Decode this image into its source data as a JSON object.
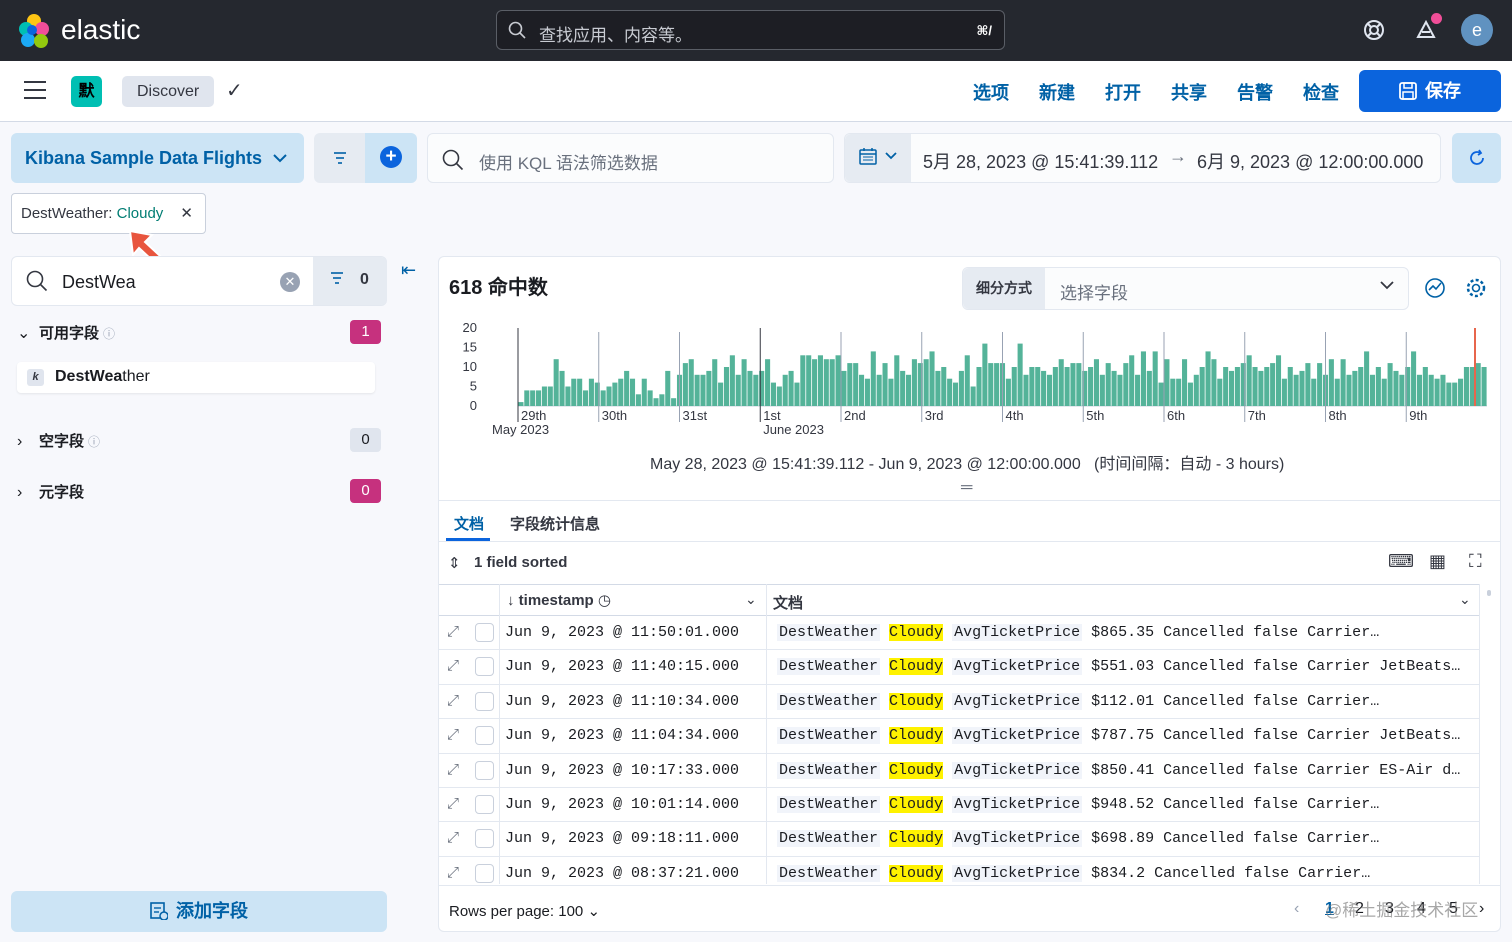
{
  "header": {
    "logo_text": "elastic",
    "search_placeholder": "查找应用、内容等。",
    "search_shortcut": "⌘/",
    "avatar_letter": "e"
  },
  "appbar": {
    "space_badge": "默",
    "breadcrumb": "Discover",
    "links": [
      "选项",
      "新建",
      "打开",
      "共享",
      "告警",
      "检查"
    ],
    "save_label": "保存"
  },
  "querybar": {
    "data_view": "Kibana Sample Data Flights",
    "kql_placeholder": "使用 KQL 语法筛选数据",
    "date_start": "5月 28, 2023 @ 15:41:39.112",
    "date_end": "6月 9, 2023 @ 12:00:00.000",
    "filter_pill": {
      "field": "DestWeather: ",
      "value": "Cloudy"
    }
  },
  "sidebar": {
    "search_value": "DestWea",
    "filter_count": "0",
    "sections": [
      {
        "label": "可用字段",
        "count": "1"
      },
      {
        "label": "空字段",
        "count": "0"
      },
      {
        "label": "元字段",
        "count": "0"
      }
    ],
    "field": {
      "type": "k",
      "match": "DestWea",
      "rest": "ther"
    },
    "add_field_label": "添加字段"
  },
  "main": {
    "hits": "618 命中数",
    "breakdown_label": "细分方式",
    "breakdown_placeholder": "选择字段",
    "interval_text": "May 28, 2023 @ 15:41:39.112 - Jun 9, 2023 @ 12:00:00.000   (时间间隔：自动 - 3 hours)",
    "tabs": [
      "文档",
      "字段统计信息"
    ],
    "sort_text": "1 field sorted",
    "columns": {
      "timestamp": "timestamp",
      "document": "文档"
    },
    "rows_per_page": "Rows per page: 100",
    "pages": [
      "1",
      "2",
      "3",
      "4",
      "5"
    ],
    "watermark": "@稀土掘金技术社区"
  },
  "rows": [
    {
      "ts": "Jun 9, 2023 @ 11:50:01.000",
      "price": "$865.35",
      "rest": "Cancelled false Carrier…"
    },
    {
      "ts": "Jun 9, 2023 @ 11:40:15.000",
      "price": "$551.03",
      "rest": "Cancelled false Carrier JetBeats…"
    },
    {
      "ts": "Jun 9, 2023 @ 11:10:34.000",
      "price": "$112.01",
      "rest": "Cancelled false Carrier…"
    },
    {
      "ts": "Jun 9, 2023 @ 11:04:34.000",
      "price": "$787.75",
      "rest": "Cancelled false Carrier JetBeats…"
    },
    {
      "ts": "Jun 9, 2023 @ 10:17:33.000",
      "price": "$850.41",
      "rest": "Cancelled false Carrier ES-Air d…"
    },
    {
      "ts": "Jun 9, 2023 @ 10:01:14.000",
      "price": "$948.52",
      "rest": "Cancelled false Carrier…"
    },
    {
      "ts": "Jun 9, 2023 @ 09:18:11.000",
      "price": "$698.89",
      "rest": "Cancelled false Carrier…"
    },
    {
      "ts": "Jun 9, 2023 @ 08:37:21.000",
      "price": "$834.2",
      "rest": "Cancelled false Carrier…"
    }
  ],
  "row_labels": {
    "field": "DestWeather",
    "value": "Cloudy",
    "price_field": "AvgTicketPrice"
  },
  "chart_data": {
    "type": "bar",
    "ylim": [
      0,
      20
    ],
    "yticks": [
      "20",
      "15",
      "10",
      "5",
      "0"
    ],
    "xticks": [
      "29th",
      "30th",
      "31st",
      "1st",
      "2nd",
      "3rd",
      "4th",
      "5th",
      "6th",
      "7th",
      "8th",
      "9th"
    ],
    "xsub": [
      "May 2023",
      "June 2023"
    ],
    "bar_color": "#54b399",
    "now_marker_color": "#e7664c",
    "values": [
      1,
      4,
      4,
      4,
      5,
      5,
      12,
      9,
      5,
      7,
      7,
      4,
      7,
      6,
      4,
      5,
      6,
      7,
      9,
      7,
      3,
      7,
      4,
      2,
      3,
      9,
      2,
      8,
      11,
      12,
      8,
      8,
      9,
      12,
      6,
      10,
      13,
      8,
      12,
      9,
      8,
      9,
      12,
      6,
      5,
      8,
      9,
      6,
      13,
      13,
      12,
      13,
      12,
      12,
      13,
      9,
      11,
      11,
      8,
      7,
      14,
      8,
      11,
      7,
      13,
      9,
      8,
      12,
      11,
      12,
      14,
      9,
      10,
      7,
      6,
      9,
      13,
      5,
      10,
      16,
      11,
      11,
      11,
      7,
      10,
      16,
      8,
      10,
      10,
      9,
      8,
      10,
      12,
      10,
      11,
      11,
      9,
      10,
      12,
      8,
      11,
      9,
      8,
      11,
      13,
      8,
      14,
      9,
      14,
      6,
      12,
      7,
      7,
      12,
      6,
      8,
      10,
      14,
      12,
      7,
      10,
      9,
      10,
      11,
      13,
      10,
      9,
      10,
      11,
      13,
      7,
      10,
      8,
      9,
      11,
      7,
      11,
      8,
      12,
      7,
      12,
      8,
      9,
      10,
      14,
      8,
      10,
      7,
      11,
      9,
      8,
      10,
      14,
      8,
      10,
      8,
      7,
      8,
      6,
      6,
      7,
      10,
      10,
      11,
      10
    ]
  }
}
